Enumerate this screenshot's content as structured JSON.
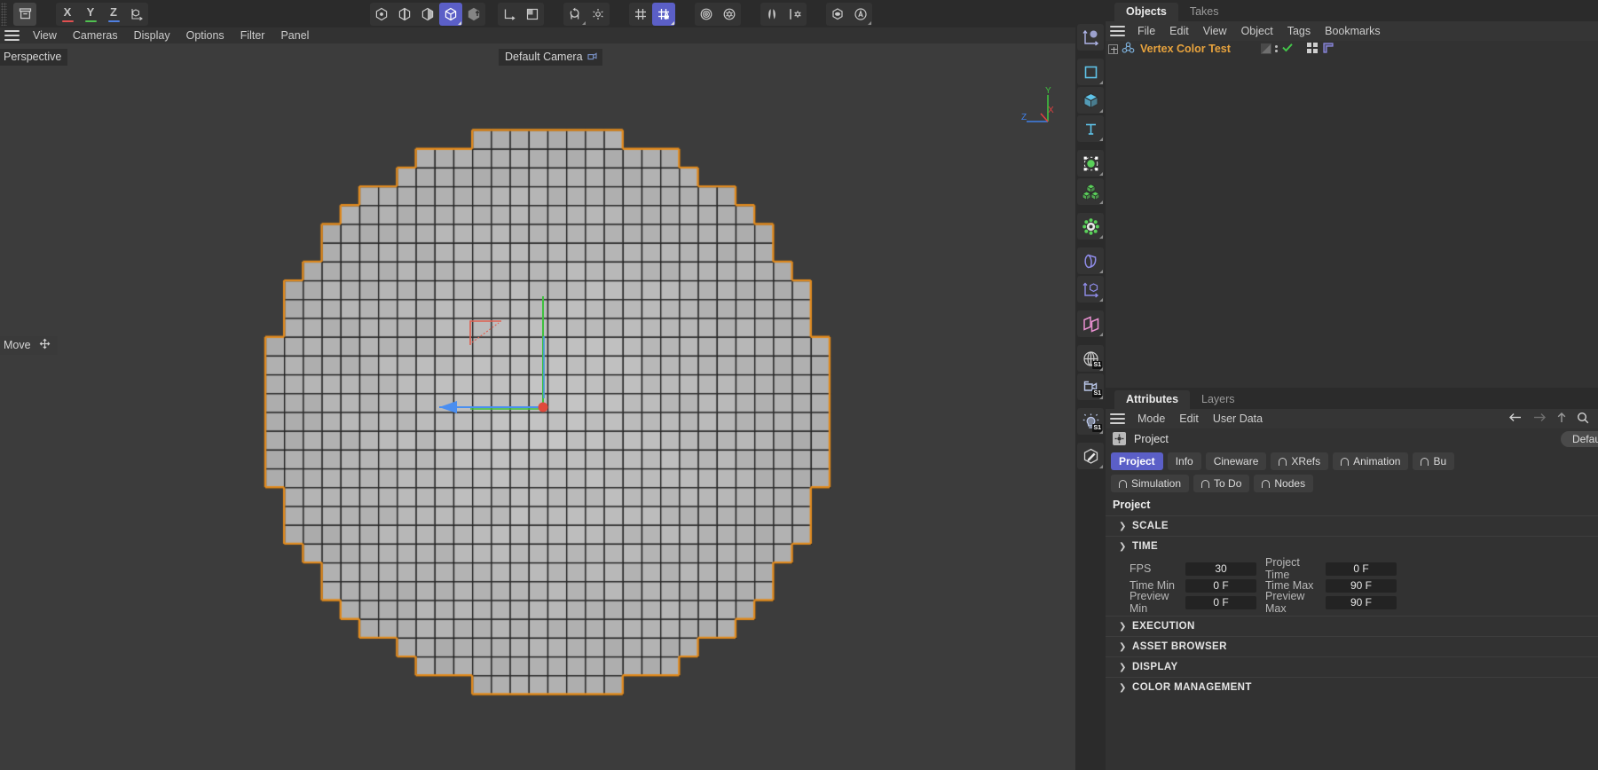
{
  "toolbar": {
    "groups": [
      {
        "name": "undo-group",
        "items": [
          {
            "icon": "archive-box-icon",
            "label": "",
            "state": "active"
          }
        ]
      },
      {
        "name": "axis-group",
        "items": [
          {
            "icon": "axis-x-icon",
            "label": "X",
            "color": "#e05050"
          },
          {
            "icon": "axis-y-icon",
            "label": "Y",
            "color": "#50c050"
          },
          {
            "icon": "axis-z-icon",
            "label": "Z",
            "color": "#5080e0"
          },
          {
            "icon": "world-axis-icon",
            "label": ""
          }
        ]
      },
      {
        "name": "selection-mode-group",
        "items": [
          {
            "icon": "point-mode-icon",
            "state": "normal"
          },
          {
            "icon": "edge-mode-icon",
            "state": "normal"
          },
          {
            "icon": "polygon-mode-icon",
            "state": "normal"
          },
          {
            "icon": "model-mode-icon",
            "state": "selected"
          },
          {
            "icon": "object-axis-mode-icon",
            "state": "normal"
          }
        ]
      },
      {
        "name": "coordinate-group",
        "items": [
          {
            "icon": "world-coordinate-icon"
          },
          {
            "icon": "texture-axis-icon"
          }
        ]
      },
      {
        "name": "snap-group",
        "items": [
          {
            "icon": "enable-snap-icon"
          },
          {
            "icon": "snap-settings-icon"
          }
        ]
      },
      {
        "name": "grid-group",
        "items": [
          {
            "icon": "workplane-icon",
            "state": "normal"
          },
          {
            "icon": "workplane-lock-icon",
            "state": "selected"
          }
        ]
      },
      {
        "name": "viewport-group",
        "items": [
          {
            "icon": "render-region-icon"
          },
          {
            "icon": "render-settings-gear-icon"
          }
        ]
      },
      {
        "name": "symmetry-group",
        "items": [
          {
            "icon": "mirror-icon"
          },
          {
            "icon": "symmetry-settings-icon"
          }
        ]
      },
      {
        "name": "visibility-group",
        "items": [
          {
            "icon": "visibility-eye-icon"
          },
          {
            "icon": "annotation-a-icon"
          }
        ]
      },
      {
        "name": "render-group",
        "items": [
          {
            "icon": "render-view-icon"
          },
          {
            "icon": "render-queue-icon"
          },
          {
            "icon": "render-settings-icon"
          }
        ]
      },
      {
        "name": "scene-nodes-group",
        "items": [
          {
            "icon": "scene-manager-icon"
          }
        ]
      }
    ]
  },
  "viewport": {
    "menu": [
      "View",
      "Cameras",
      "Display",
      "Options",
      "Filter",
      "Panel"
    ],
    "perspective_label": "Perspective",
    "camera_label": "Default Camera",
    "camera_icon": "camera-lock-icon",
    "tool_label": "Move",
    "tool_icon": "move-cross-icon",
    "background_color": "#3c3c3c",
    "selection_outline_color": "#e08a1e",
    "axis_gizmo": {
      "x": {
        "label": "X",
        "color": "#e04040"
      },
      "y": {
        "label": "Y",
        "color": "#3fc03f"
      },
      "z": {
        "label": "Z",
        "color": "#4080e8"
      }
    },
    "move_gizmo": {
      "origin_color": "#e04a3c",
      "x_arrow_color": "#4a8ef0",
      "y_axis_color": "#3fc03f",
      "z_axis_color": "#e06050"
    },
    "object": {
      "name": "voxel-sphere",
      "fill_color": "#b9b9b9",
      "edge_color": "#1a1a1a"
    }
  },
  "rail": {
    "items": [
      {
        "name": "rail-item-null-object",
        "icon": "axis-sphere-icon",
        "color": "#aeb4e8",
        "badge": ""
      },
      {
        "name": "rail-item-spline",
        "icon": "spline-square-icon",
        "color": "#5fc3e8",
        "badge": ""
      },
      {
        "name": "rail-item-primitive-cube",
        "icon": "cube-icon",
        "color": "#5fc3e8",
        "badge": ""
      },
      {
        "name": "rail-item-text",
        "icon": "text-t-icon",
        "color": "#5fc3e8",
        "badge": ""
      },
      {
        "name": "rail-item-deformer",
        "icon": "deformer-points-icon",
        "color": "#5ad15a",
        "badge": ""
      },
      {
        "name": "rail-item-cloner",
        "icon": "cloner-cubes-icon",
        "color": "#5ad15a",
        "badge": ""
      },
      {
        "name": "rail-item-effector",
        "icon": "effector-gear-icon",
        "color": "#5ad15a",
        "badge": ""
      },
      {
        "name": "rail-item-bend-deformer",
        "icon": "bend-deformer-icon",
        "color": "#8f8ce8",
        "badge": ""
      },
      {
        "name": "rail-item-axis-cube",
        "icon": "axis-cube-icon",
        "color": "#8f8ce8",
        "badge": ""
      },
      {
        "name": "rail-item-field",
        "icon": "field-plane-icon",
        "color": "#e88fd0",
        "badge": ""
      },
      {
        "name": "rail-item-environment",
        "icon": "globe-icon",
        "color": "#cfcfcf",
        "badge": "S1"
      },
      {
        "name": "rail-item-camera",
        "icon": "camera-icon",
        "color": "#b9c6e8",
        "badge": "S1"
      },
      {
        "name": "rail-item-light",
        "icon": "light-bulb-icon",
        "color": "#b9c6e8",
        "badge": "S1"
      },
      {
        "name": "rail-item-material",
        "icon": "material-pencil-icon",
        "color": "#cfcfcf",
        "badge": ""
      }
    ]
  },
  "object_manager": {
    "tabs": [
      {
        "label": "Objects",
        "active": true
      },
      {
        "label": "Takes",
        "active": false
      }
    ],
    "menu": [
      "File",
      "Edit",
      "View",
      "Object",
      "Tags",
      "Bookmarks"
    ],
    "rows": [
      {
        "name": "Vertex Color Test",
        "expand_icon": "expand-plus-icon",
        "object_icon": "polygon-object-icon",
        "name_color": "#e8a33d",
        "tags": [
          "phong-tag-icon",
          "visibility-dots-icon",
          "enabled-check-icon",
          "vertex-color-tag-icon",
          "layer-tag-icon"
        ]
      }
    ]
  },
  "attributes": {
    "tabs": [
      {
        "label": "Attributes",
        "active": true
      },
      {
        "label": "Layers",
        "active": false
      }
    ],
    "menu": [
      "Mode",
      "Edit",
      "User Data"
    ],
    "nav_icons": [
      "back-arrow-icon",
      "forward-arrow-icon",
      "up-arrow-icon",
      "search-icon"
    ],
    "object_row": {
      "icon": "project-settings-icon",
      "label": "Project",
      "preset": "Default"
    },
    "chips": [
      {
        "label": "Project",
        "active": true,
        "arc": false
      },
      {
        "label": "Info",
        "active": false,
        "arc": false
      },
      {
        "label": "Cineware",
        "active": false,
        "arc": false
      },
      {
        "label": "XRefs",
        "active": false,
        "arc": true
      },
      {
        "label": "Animation",
        "active": false,
        "arc": true
      },
      {
        "label": "Bu",
        "active": false,
        "arc": true
      },
      {
        "label": "Simulation",
        "active": false,
        "arc": true
      },
      {
        "label": "To Do",
        "active": false,
        "arc": true
      },
      {
        "label": "Nodes",
        "active": false,
        "arc": true
      }
    ],
    "panel_title": "Project",
    "sections": [
      {
        "label": "SCALE",
        "expanded": false
      },
      {
        "label": "TIME",
        "expanded": true
      },
      {
        "label": "EXECUTION",
        "expanded": false
      },
      {
        "label": "ASSET BROWSER",
        "expanded": false
      },
      {
        "label": "DISPLAY",
        "expanded": false
      },
      {
        "label": "COLOR MANAGEMENT",
        "expanded": false
      }
    ],
    "time_fields": [
      {
        "label_left": "FPS",
        "value_left": "30",
        "label_right": "Project Time",
        "value_right": "0 F"
      },
      {
        "label_left": "Time Min",
        "value_left": "0 F",
        "label_right": "Time Max",
        "value_right": "90 F"
      },
      {
        "label_left": "Preview Min",
        "value_left": "0 F",
        "label_right": "Preview Max",
        "value_right": "90 F"
      }
    ]
  }
}
